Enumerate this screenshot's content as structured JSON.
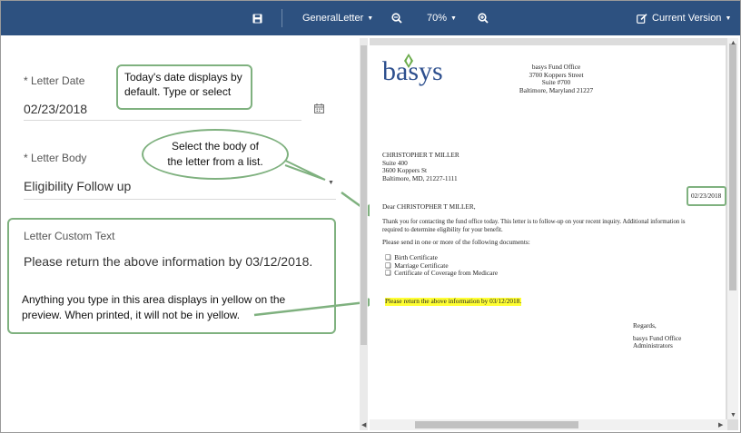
{
  "toolbar": {
    "template_label": "GeneralLetter",
    "zoom_label": "70%",
    "version_label": "Current Version"
  },
  "form": {
    "letter_date_label": "* Letter Date",
    "letter_date_value": "02/23/2018",
    "letter_body_label": "* Letter Body",
    "letter_body_value": "Eligibility Follow up",
    "custom_text_label": "Letter Custom Text",
    "custom_text_value": "Please return the above information by 03/12/2018."
  },
  "callouts": {
    "date_line1": "Today's date displays by",
    "date_line2": "default. Type or select",
    "body_line1": "Select the body of",
    "body_line2": "the letter from a list.",
    "custom_line1": "Anything you type in this area displays in yellow on the",
    "custom_line2": "preview. When printed, it will not be in yellow."
  },
  "letter": {
    "logo_text": "basys",
    "office_name": "basys Fund Office",
    "office_street": "3700 Koppers Street",
    "office_suite": "Suite #700",
    "office_city": "Baltimore, Maryland 21227",
    "recipient_name": "CHRISTOPHER T MILLER",
    "recipient_suite": "Suite 400",
    "recipient_street": "3600 Koppers St",
    "recipient_city": "Baltimore, MD, 21227-1111",
    "date": "02/23/2018",
    "salutation": "Dear CHRISTOPHER T MILLER,",
    "body_line1": "Thank you for contacting the fund office today.  This letter is to follow-up on your recent inquiry.  Additional information is",
    "body_line2": "required to determine eligibility for your benefit.",
    "documents_intro": "Please send in one or more of the following documents:",
    "documents": [
      "Birth Certificate",
      "Marriage Certificate",
      "Certificate of Coverage from Medicare"
    ],
    "custom_text": "Please return the above information by 03/12/2018.",
    "closing": "Regards,",
    "signature_line1": "basys Fund Office",
    "signature_line2": "Administrators"
  },
  "icons": {
    "save": "save-icon",
    "zoom_out": "zoom-out-icon",
    "zoom_in": "zoom-in-icon",
    "edit": "edit-icon",
    "calendar": "calendar-icon"
  },
  "colors": {
    "toolbar_bg": "#2d5180",
    "callout_border": "#7fb17f",
    "highlight": "#ffff33",
    "logo_blue": "#2d4f8e",
    "logo_green": "#6aab4a"
  }
}
